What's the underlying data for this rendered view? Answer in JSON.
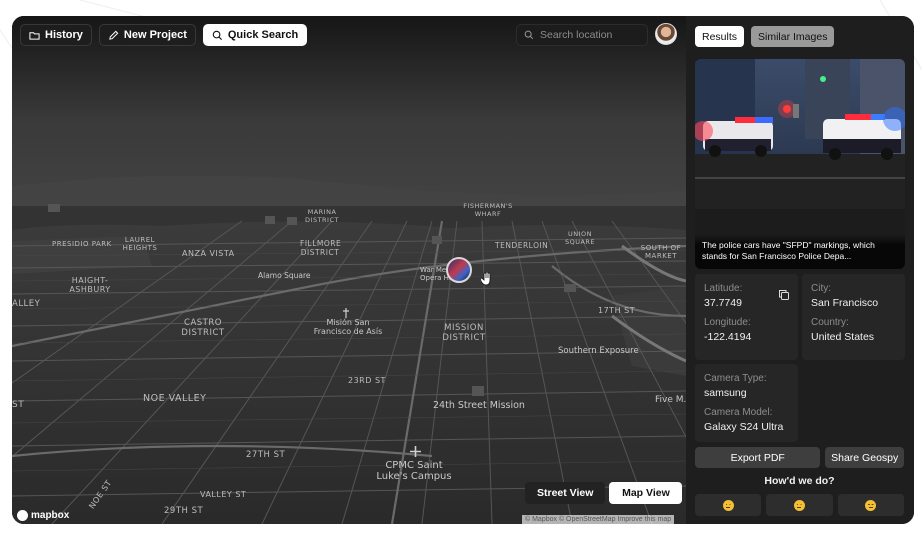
{
  "toolbar": {
    "history_label": "History",
    "new_project_label": "New Project",
    "quick_search_label": "Quick Search",
    "search_placeholder": "Search location"
  },
  "map": {
    "labels": {
      "fishermans_wharf": "FISHERMAN'S WHARF",
      "marina_district": "MARINA DISTRICT",
      "presidio_park": "PRESIDIO PARK",
      "laurel_heights": "LAUREL HEIGHTS",
      "anza_vista": "ANZA VISTA",
      "fillmore_district": "FILLMORE DISTRICT",
      "tenderloin": "TENDERLOIN",
      "union_square": "UNION SQUARE",
      "south_of_market": "SOUTH OF MARKET",
      "haight_ashbury": "HAIGHT-ASHBURY",
      "alley": "ALLEY",
      "alamo_square": "Alamo Square",
      "war_memorial": "War Me... Opera H...",
      "castro_district": "CASTRO DISTRICT",
      "mision_san_francisco": "Misión San Francisco de Asís",
      "mission_district": "MISSION DISTRICT",
      "st_17th": "17TH ST",
      "southern_exposure": "Southern Exposure",
      "st_23rd": "23RD ST",
      "noe_valley": "NOE VALLEY",
      "st_24th_mission": "24th Street Mission",
      "five_m": "Five M...",
      "st_27th": "27TH ST",
      "cpmc": "CPMC Saint Luke's Campus",
      "valley_st": "VALLEY ST",
      "noe_st": "NOE ST",
      "st_29th": "29TH ST",
      "st_left_edge": "ST"
    },
    "street_view_label": "Street View",
    "map_view_label": "Map View",
    "mapbox_label": "mapbox",
    "attribution": "© Mapbox © OpenStreetMap  Improve this map"
  },
  "panel": {
    "tab_results": "Results",
    "tab_similar": "Similar Images",
    "caption": "The police cars have \"SFPD\" markings, which stands for San Francisco Police Depa...",
    "latitude_label": "Latitude:",
    "latitude_value": "37.7749",
    "longitude_label": "Longitude:",
    "longitude_value": "-122.4194",
    "city_label": "City:",
    "city_value": "San Francisco",
    "country_label": "Country:",
    "country_value": "United States",
    "camera_type_label": "Camera Type:",
    "camera_type_value": "samsung",
    "camera_model_label": "Camera Model:",
    "camera_model_value": "Galaxy S24 Ultra",
    "export_pdf_label": "Export PDF",
    "share_label": "Share Geospy",
    "feedback_question": "How'd we do?"
  },
  "icons": [
    "folder-icon",
    "pencil-icon",
    "search-icon",
    "copy-icon",
    "hand-cursor-icon",
    "plus-icon",
    "emoji-sad-icon",
    "emoji-neutral-icon",
    "emoji-happy-icon"
  ]
}
